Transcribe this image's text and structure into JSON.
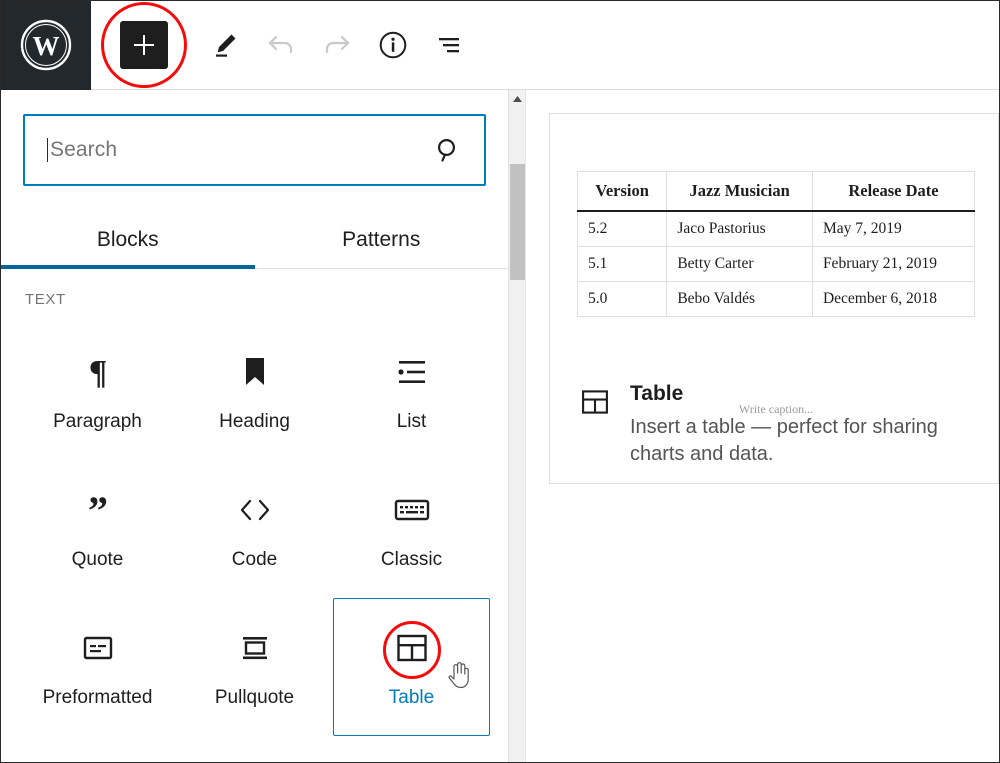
{
  "toolbar": {
    "logo_label": "WordPress",
    "items": [
      {
        "name": "block-inserter",
        "label": "Add block",
        "icon": "plus-icon",
        "state": "annotated"
      },
      {
        "name": "tools-edit",
        "label": "Tools",
        "icon": "pencil-icon",
        "state": "active"
      },
      {
        "name": "undo",
        "label": "Undo",
        "icon": "undo-arrow-icon",
        "state": "disabled"
      },
      {
        "name": "redo",
        "label": "Redo",
        "icon": "redo-arrow-icon",
        "state": "disabled"
      },
      {
        "name": "details",
        "label": "Details",
        "icon": "info-circle-icon",
        "state": "default"
      },
      {
        "name": "list-view",
        "label": "List view",
        "icon": "list-view-icon",
        "state": "default"
      }
    ]
  },
  "inserter": {
    "search": {
      "value": "",
      "placeholder": "Search",
      "icon": "search-icon"
    },
    "tabs": [
      {
        "label": "Blocks",
        "active": true
      },
      {
        "label": "Patterns",
        "active": false
      }
    ],
    "section_label": "TEXT",
    "blocks": [
      {
        "label": "Paragraph",
        "icon": "pilcrow-icon",
        "selected": false
      },
      {
        "label": "Heading",
        "icon": "bookmark-icon",
        "selected": false
      },
      {
        "label": "List",
        "icon": "bullet-list-icon",
        "selected": false
      },
      {
        "label": "Quote",
        "icon": "quote-marks-icon",
        "selected": false
      },
      {
        "label": "Code",
        "icon": "angle-brackets-icon",
        "selected": false
      },
      {
        "label": "Classic",
        "icon": "keyboard-icon",
        "selected": false
      },
      {
        "label": "Preformatted",
        "icon": "preformatted-icon",
        "selected": false
      },
      {
        "label": "Pullquote",
        "icon": "pullquote-icon",
        "selected": false
      },
      {
        "label": "Table",
        "icon": "table-icon",
        "selected": true
      }
    ]
  },
  "preview": {
    "table": {
      "headers": [
        "Version",
        "Jazz Musician",
        "Release Date"
      ],
      "rows": [
        [
          "5.2",
          "Jaco Pastorius",
          "May 7, 2019"
        ],
        [
          "5.1",
          "Betty Carter",
          "February 21, 2019"
        ],
        [
          "5.0",
          "Bebo Valdés",
          "December 6, 2018"
        ]
      ],
      "caption_placeholder": "Write caption..."
    },
    "info": {
      "icon": "table-icon",
      "title": "Table",
      "description": "Insert a table — perfect for sharing charts and data."
    }
  },
  "colors": {
    "accent_blue": "#007cba",
    "tab_underline": "#00669b",
    "annotation_red": "#f60a0a",
    "admin_dark": "#23282d",
    "muted_text": "#757575"
  }
}
